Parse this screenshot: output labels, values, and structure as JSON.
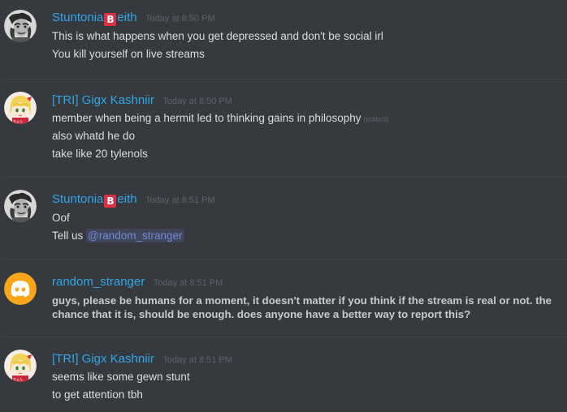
{
  "messages": [
    {
      "author": "Stuntonia",
      "badge": "B",
      "author_suffix": "eith",
      "timestamp": "Today at 8:50 PM",
      "lines": [
        "This is what happens when you get depressed and don't be social irl",
        "You kill yourself on live streams"
      ]
    },
    {
      "author": "[TRI] Gigx Kashniir",
      "timestamp": "Today at 8:50 PM",
      "lines": [
        "member when being a hermit led to thinking gains in philosophy",
        "also whatd he do",
        "take like 20 tylenols"
      ],
      "edited_label": "(edited)"
    },
    {
      "author": "Stuntonia",
      "badge": "B",
      "author_suffix": "eith",
      "timestamp": "Today at 8:51 PM",
      "lines": [
        "Oof"
      ],
      "mention_prefix": "Tell us ",
      "mention": "@random_stranger"
    },
    {
      "author": "random_stranger",
      "timestamp": "Today at 8:51 PM",
      "bold_text": "guys, please be humans for a moment, it doesn't matter if you think if the stream is real or not. the chance that it is, should be enough. does anyone have a better way to report this?"
    },
    {
      "author": "[TRI] Gigx Kashniir",
      "timestamp": "Today at 8:51 PM",
      "lines": [
        "seems like some gewn stunt",
        "to get attention tbh"
      ]
    }
  ],
  "colors": {
    "background": "#36393e",
    "username": "#31a7e8",
    "text": "#dcddde",
    "timestamp": "#5f6369",
    "mention": "#7289da",
    "badge": "#dd2e44",
    "discord_avatar": "#faa61a"
  },
  "icons": [
    "grayscale-portrait-avatar",
    "anime-girl-avatar",
    "discord-logo-avatar"
  ]
}
